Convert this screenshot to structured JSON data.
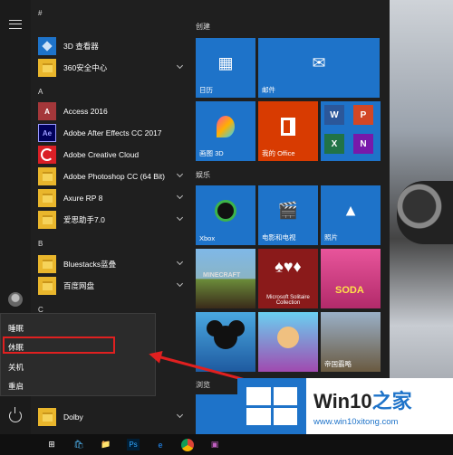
{
  "start_menu": {
    "letters": [
      "#",
      "A",
      "B",
      "C"
    ],
    "apps": [
      {
        "label": "3D 查看器",
        "icon": "cube-icon"
      },
      {
        "label": "360安全中心",
        "icon": "folder-icon"
      },
      {
        "label": "Access 2016",
        "icon": "access-icon"
      },
      {
        "label": "Adobe After Effects CC 2017",
        "icon": "ae-icon"
      },
      {
        "label": "Adobe Creative Cloud",
        "icon": "creative-cloud-icon"
      },
      {
        "label": "Adobe Photoshop CC (64 Bit)",
        "icon": "folder-icon"
      },
      {
        "label": "Axure RP 8",
        "icon": "folder-icon"
      },
      {
        "label": "爱思助手7.0",
        "icon": "folder-icon"
      },
      {
        "label": "Bluestacks蓝叠",
        "icon": "folder-icon"
      },
      {
        "label": "百度网盘",
        "icon": "folder-icon"
      },
      {
        "label": "Dolby",
        "icon": "folder-icon"
      }
    ]
  },
  "tiles": {
    "section_create": "创建",
    "section_entertainment": "娱乐",
    "section_browse": "浏览",
    "calendar": "日历",
    "mail": "邮件",
    "paint3d": "画图 3D",
    "office": "我的 Office",
    "xbox": "Xbox",
    "movies": "电影和电视",
    "photos": "照片",
    "minecraft": "MINECRAFT",
    "solitaire": "Microsoft Solitaire Collection",
    "soda": "SODA",
    "empire": "帝国霸略"
  },
  "power_menu": {
    "sleep": "睡眠",
    "hibernate": "休眠",
    "shutdown": "关机",
    "restart": "重启"
  },
  "watermark": {
    "brand_en": "Win10",
    "brand_zh": "之家",
    "url": "www.win10xitong.com"
  },
  "colors": {
    "accent": "#1e73c9",
    "highlight": "#e02020",
    "office": "#d83b01"
  }
}
